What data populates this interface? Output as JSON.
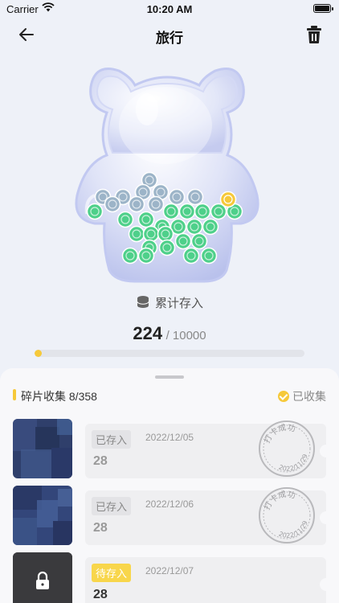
{
  "status_bar": {
    "carrier": "Carrier",
    "time": "10:20 AM"
  },
  "nav": {
    "title": "旅行"
  },
  "jar": {
    "coins_saved": 28,
    "coin_color": "#4ed08a",
    "pending_coin_color": "#9cb4c8",
    "highlight_coin_color": "#f6c93a"
  },
  "summary": {
    "label": "累计存入",
    "amount": "224",
    "goal": "/ 10000",
    "progress_fraction": 0.0224
  },
  "sheet": {
    "label": "碎片收集 8/358",
    "collected_label": "已收集"
  },
  "cards": [
    {
      "tag": "已存入",
      "date": "2022/12/05",
      "amount": "28",
      "stamp_text": "打卡成功",
      "stamp_date": "2022/11/29",
      "locked": false,
      "pending": false
    },
    {
      "tag": "已存入",
      "date": "2022/12/06",
      "amount": "28",
      "stamp_text": "打卡成功",
      "stamp_date": "2022/11/29",
      "locked": false,
      "pending": false
    },
    {
      "tag": "待存入",
      "date": "2022/12/07",
      "amount": "28",
      "stamp_text": "",
      "stamp_date": "",
      "locked": true,
      "pending": true
    }
  ],
  "colors": {
    "accent": "#f6c93a",
    "background": "#eef1f8",
    "sheet": "#f8f8fa"
  },
  "icons": [
    "back-arrow-icon",
    "trash-icon",
    "wifi-icon",
    "battery-icon",
    "database-icon",
    "check-circle-icon",
    "lock-icon",
    "stamp-icon"
  ]
}
